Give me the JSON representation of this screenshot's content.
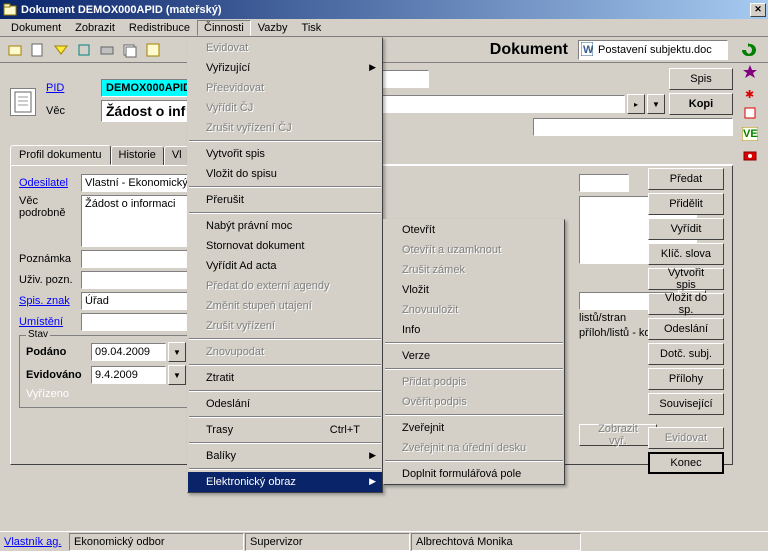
{
  "window": {
    "title": "Dokument DEMOX000APID (mateřský)"
  },
  "menubar": {
    "items": [
      "Dokument",
      "Zobrazit",
      "Redistribuce",
      "Činnosti",
      "Vazby",
      "Tisk"
    ],
    "open_index": 3
  },
  "toolbar_right": {
    "label": "Dokument",
    "doc_name": "Postavení subjektu.doc"
  },
  "header": {
    "pid_label": "PID",
    "pid_value": "DEMOX000APID",
    "vec_label": "Věc",
    "vec_value": "Žádost o inf",
    "spis_btn": "Spis",
    "kopie_btn": "Kopi"
  },
  "tabs": [
    "Profil dokumentu",
    "Historie",
    "Vl"
  ],
  "form": {
    "odesilatel_lbl": "Odesilatel",
    "odesilatel_val": "Vlastní - Ekonomický o",
    "vec_podrobne_lbl": "Věc podrobně",
    "vec_podrobne_val": "Žádost o informaci",
    "poznamka_lbl": "Poznámka",
    "uziv_pozn_lbl": "Uživ. pozn.",
    "spis_znak_lbl": "Spis. znak",
    "spis_znak_val": "Úřad",
    "umisteni_lbl": "Umístění",
    "listu_lbl": "listů/stran",
    "priloh_lbl": "příloh/listů - kopií",
    "more_btn": ">>"
  },
  "stav": {
    "legend": "Stav",
    "podano_lbl": "Podáno",
    "podano_val": "09.04.2009",
    "evidovano_lbl": "Evidováno",
    "evidovano_val": "9.4.2009",
    "vyrizeno_lbl": "Vyřízeno",
    "zobrazit_btn": "Zobrazit vyř."
  },
  "right_buttons": [
    "Předat",
    "Přidělit",
    "Vyřídit",
    "Klíč. slova",
    "Vytvořit spis",
    "Vložit do sp.",
    "Odeslání",
    "Dotč. subj.",
    "Přílohy",
    "Související",
    "Evidovat",
    "Konec"
  ],
  "statusbar": {
    "vlastnik_lbl": "Vlastník ag.",
    "vlastnik_val": "Ekonomický odbor",
    "supervizor_lbl": "Supervizor",
    "user_val": "Albrechtová Monika"
  },
  "menu_cinnosti": [
    {
      "t": "Evidovat",
      "d": true
    },
    {
      "t": "Vyřizující",
      "d": false,
      "sub": true
    },
    {
      "t": "Přeevidovat",
      "d": true
    },
    {
      "t": "Vyřídit ČJ",
      "d": true
    },
    {
      "t": "Zrušit vyřízení ČJ",
      "d": true
    },
    {
      "sep": true
    },
    {
      "t": "Vytvořit spis",
      "d": false
    },
    {
      "t": "Vložit do spisu",
      "d": false
    },
    {
      "sep": true
    },
    {
      "t": "Přerušit",
      "d": false
    },
    {
      "sep": true
    },
    {
      "t": "Nabýt právní moc",
      "d": false
    },
    {
      "t": "Stornovat dokument",
      "d": false
    },
    {
      "t": "Vyřídit Ad acta",
      "d": false
    },
    {
      "t": "Předat do externí agendy",
      "d": true
    },
    {
      "t": "Změnit stupeň utajení",
      "d": true
    },
    {
      "t": "Zrušit vyřízení",
      "d": true
    },
    {
      "sep": true
    },
    {
      "t": "Znovupodat",
      "d": true
    },
    {
      "sep": true
    },
    {
      "t": "Ztratit",
      "d": false
    },
    {
      "sep": true
    },
    {
      "t": "Odeslání",
      "d": false
    },
    {
      "sep": true
    },
    {
      "t": "Trasy",
      "d": false,
      "sh": "Ctrl+T"
    },
    {
      "sep": true
    },
    {
      "t": "Balíky",
      "d": false,
      "sub": true
    },
    {
      "sep": true
    },
    {
      "t": "Elektronický obraz",
      "d": false,
      "sub": true,
      "hl": true
    }
  ],
  "submenu_eo": [
    {
      "t": "Otevřít",
      "d": false
    },
    {
      "t": "Otevřít a uzamknout",
      "d": true
    },
    {
      "t": "Zrušit zámek",
      "d": true
    },
    {
      "t": "Vložit",
      "d": false
    },
    {
      "t": "Znovuuložit",
      "d": true
    },
    {
      "t": "Info",
      "d": false
    },
    {
      "sep": true
    },
    {
      "t": "Verze",
      "d": false
    },
    {
      "sep": true
    },
    {
      "t": "Přidat podpis",
      "d": true
    },
    {
      "t": "Ověřit podpis",
      "d": true
    },
    {
      "sep": true
    },
    {
      "t": "Zveřejnit",
      "d": false
    },
    {
      "t": "Zveřejnit na úřední desku",
      "d": true
    },
    {
      "sep": true
    },
    {
      "t": "Doplnit formulářová pole",
      "d": false
    }
  ]
}
